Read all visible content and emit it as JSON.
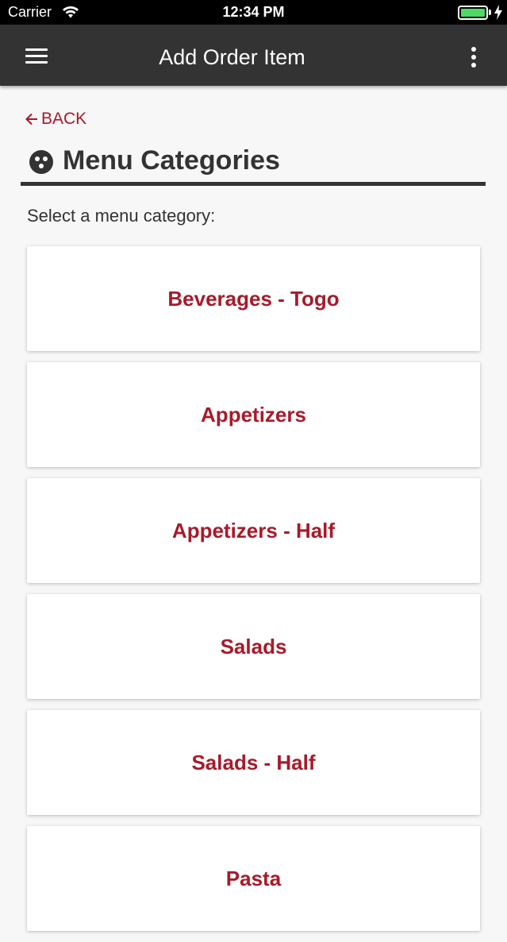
{
  "status_bar": {
    "carrier": "Carrier",
    "time": "12:34 PM",
    "battery_level": 1.0,
    "battery_color": "#4cd964"
  },
  "app_bar": {
    "title": "Add Order Item",
    "menu_icon": "hamburger-icon",
    "more_icon": "more-vertical-icon",
    "background": "#333333"
  },
  "back": {
    "label": "BACK",
    "icon": "arrow-left-icon"
  },
  "section": {
    "heading": "Menu Categories",
    "icon": "bowling-ball-icon"
  },
  "instruction": "Select a menu category:",
  "accent_color": "#a81a2a",
  "categories": [
    {
      "label": "Beverages - Togo"
    },
    {
      "label": "Appetizers"
    },
    {
      "label": "Appetizers - Half"
    },
    {
      "label": "Salads"
    },
    {
      "label": "Salads - Half"
    },
    {
      "label": "Pasta"
    }
  ]
}
